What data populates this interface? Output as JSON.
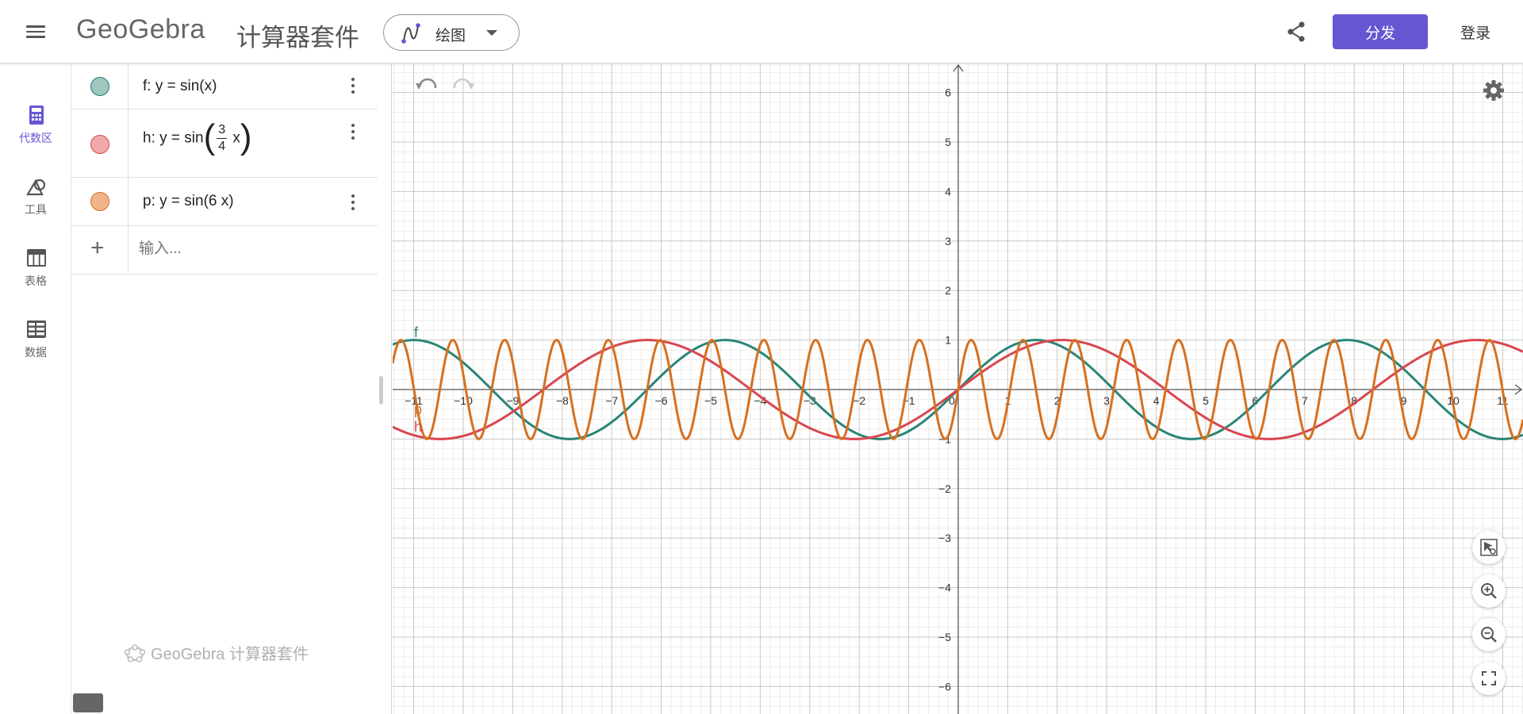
{
  "header": {
    "logo_text": "GeoGebra",
    "suite_title": "计算器套件",
    "app_picker_label": "绘图",
    "share_button": "分发",
    "login_button": "登录"
  },
  "sidebar": {
    "items": [
      {
        "label": "代数区",
        "icon": "calculator-icon",
        "active": true
      },
      {
        "label": "工具",
        "icon": "tools-icon"
      },
      {
        "label": "表格",
        "icon": "table-icon"
      },
      {
        "label": "数据",
        "icon": "data-icon"
      }
    ]
  },
  "algebra": {
    "rows": [
      {
        "name": "f",
        "prefix": "f: y = sin(x)",
        "color": "#1f7f72",
        "fill": "#9fc6c0"
      },
      {
        "name": "h",
        "prefix": "h: y = sin",
        "num": "3",
        "den": "4",
        "suffix": "x",
        "color": "#d9464f",
        "fill": "#f0a8ab"
      },
      {
        "name": "p",
        "prefix": "p: y = sin(6 x)",
        "color": "#d67020",
        "fill": "#f0b48a"
      }
    ],
    "input_placeholder": "输入...",
    "watermark": "GeoGebra 计算器套件"
  },
  "graphics": {
    "x_ticks": [
      "−11",
      "−10",
      "−9",
      "−8",
      "−7",
      "−6",
      "−5",
      "−4",
      "−3",
      "−2",
      "−1",
      "0",
      "1",
      "2",
      "3",
      "4",
      "5",
      "6",
      "7",
      "8",
      "9",
      "10",
      "11"
    ],
    "y_ticks": [
      "6",
      "5",
      "4",
      "3",
      "2",
      "1",
      "−1",
      "−2",
      "−3",
      "−4",
      "−5",
      "−6"
    ],
    "curve_labels": {
      "f": "f",
      "h": "h",
      "p": "p"
    },
    "functions": [
      {
        "name": "f",
        "k": 1,
        "color": "#2a8577"
      },
      {
        "name": "h",
        "k": 0.75,
        "color": "#d9464f"
      },
      {
        "name": "p",
        "k": 6,
        "color": "#d67020"
      }
    ]
  }
}
